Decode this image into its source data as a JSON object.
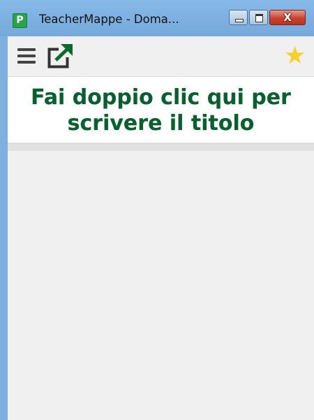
{
  "window": {
    "title": "TeacherMappe - Doma...",
    "app_icon_letter": "P",
    "close_glyph": "X"
  },
  "toolbar": {
    "menu_icon": "hamburger-menu-icon",
    "open_external_icon": "open-in-new-window-icon",
    "favorite_icon": "star-icon",
    "favorite_color": "#f9cf2a"
  },
  "map": {
    "title_line1": "Fai doppio clic qui per",
    "title_line2": "scrivere il titolo",
    "title_color": "#0b5e2f"
  }
}
